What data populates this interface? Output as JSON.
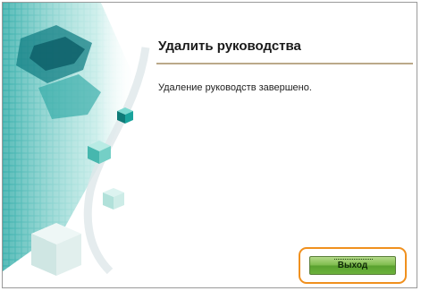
{
  "dialog": {
    "heading": "Удалить руководства",
    "message": "Удаление руководств завершено.",
    "exit_label": "Выход"
  },
  "colors": {
    "accent_border": "#f0901e",
    "rule": "#bba98a",
    "button_green": "#6cb23c",
    "art_teal": "#2fb8b0"
  },
  "icons": {
    "decoration": "teal-cubes-illustration"
  }
}
